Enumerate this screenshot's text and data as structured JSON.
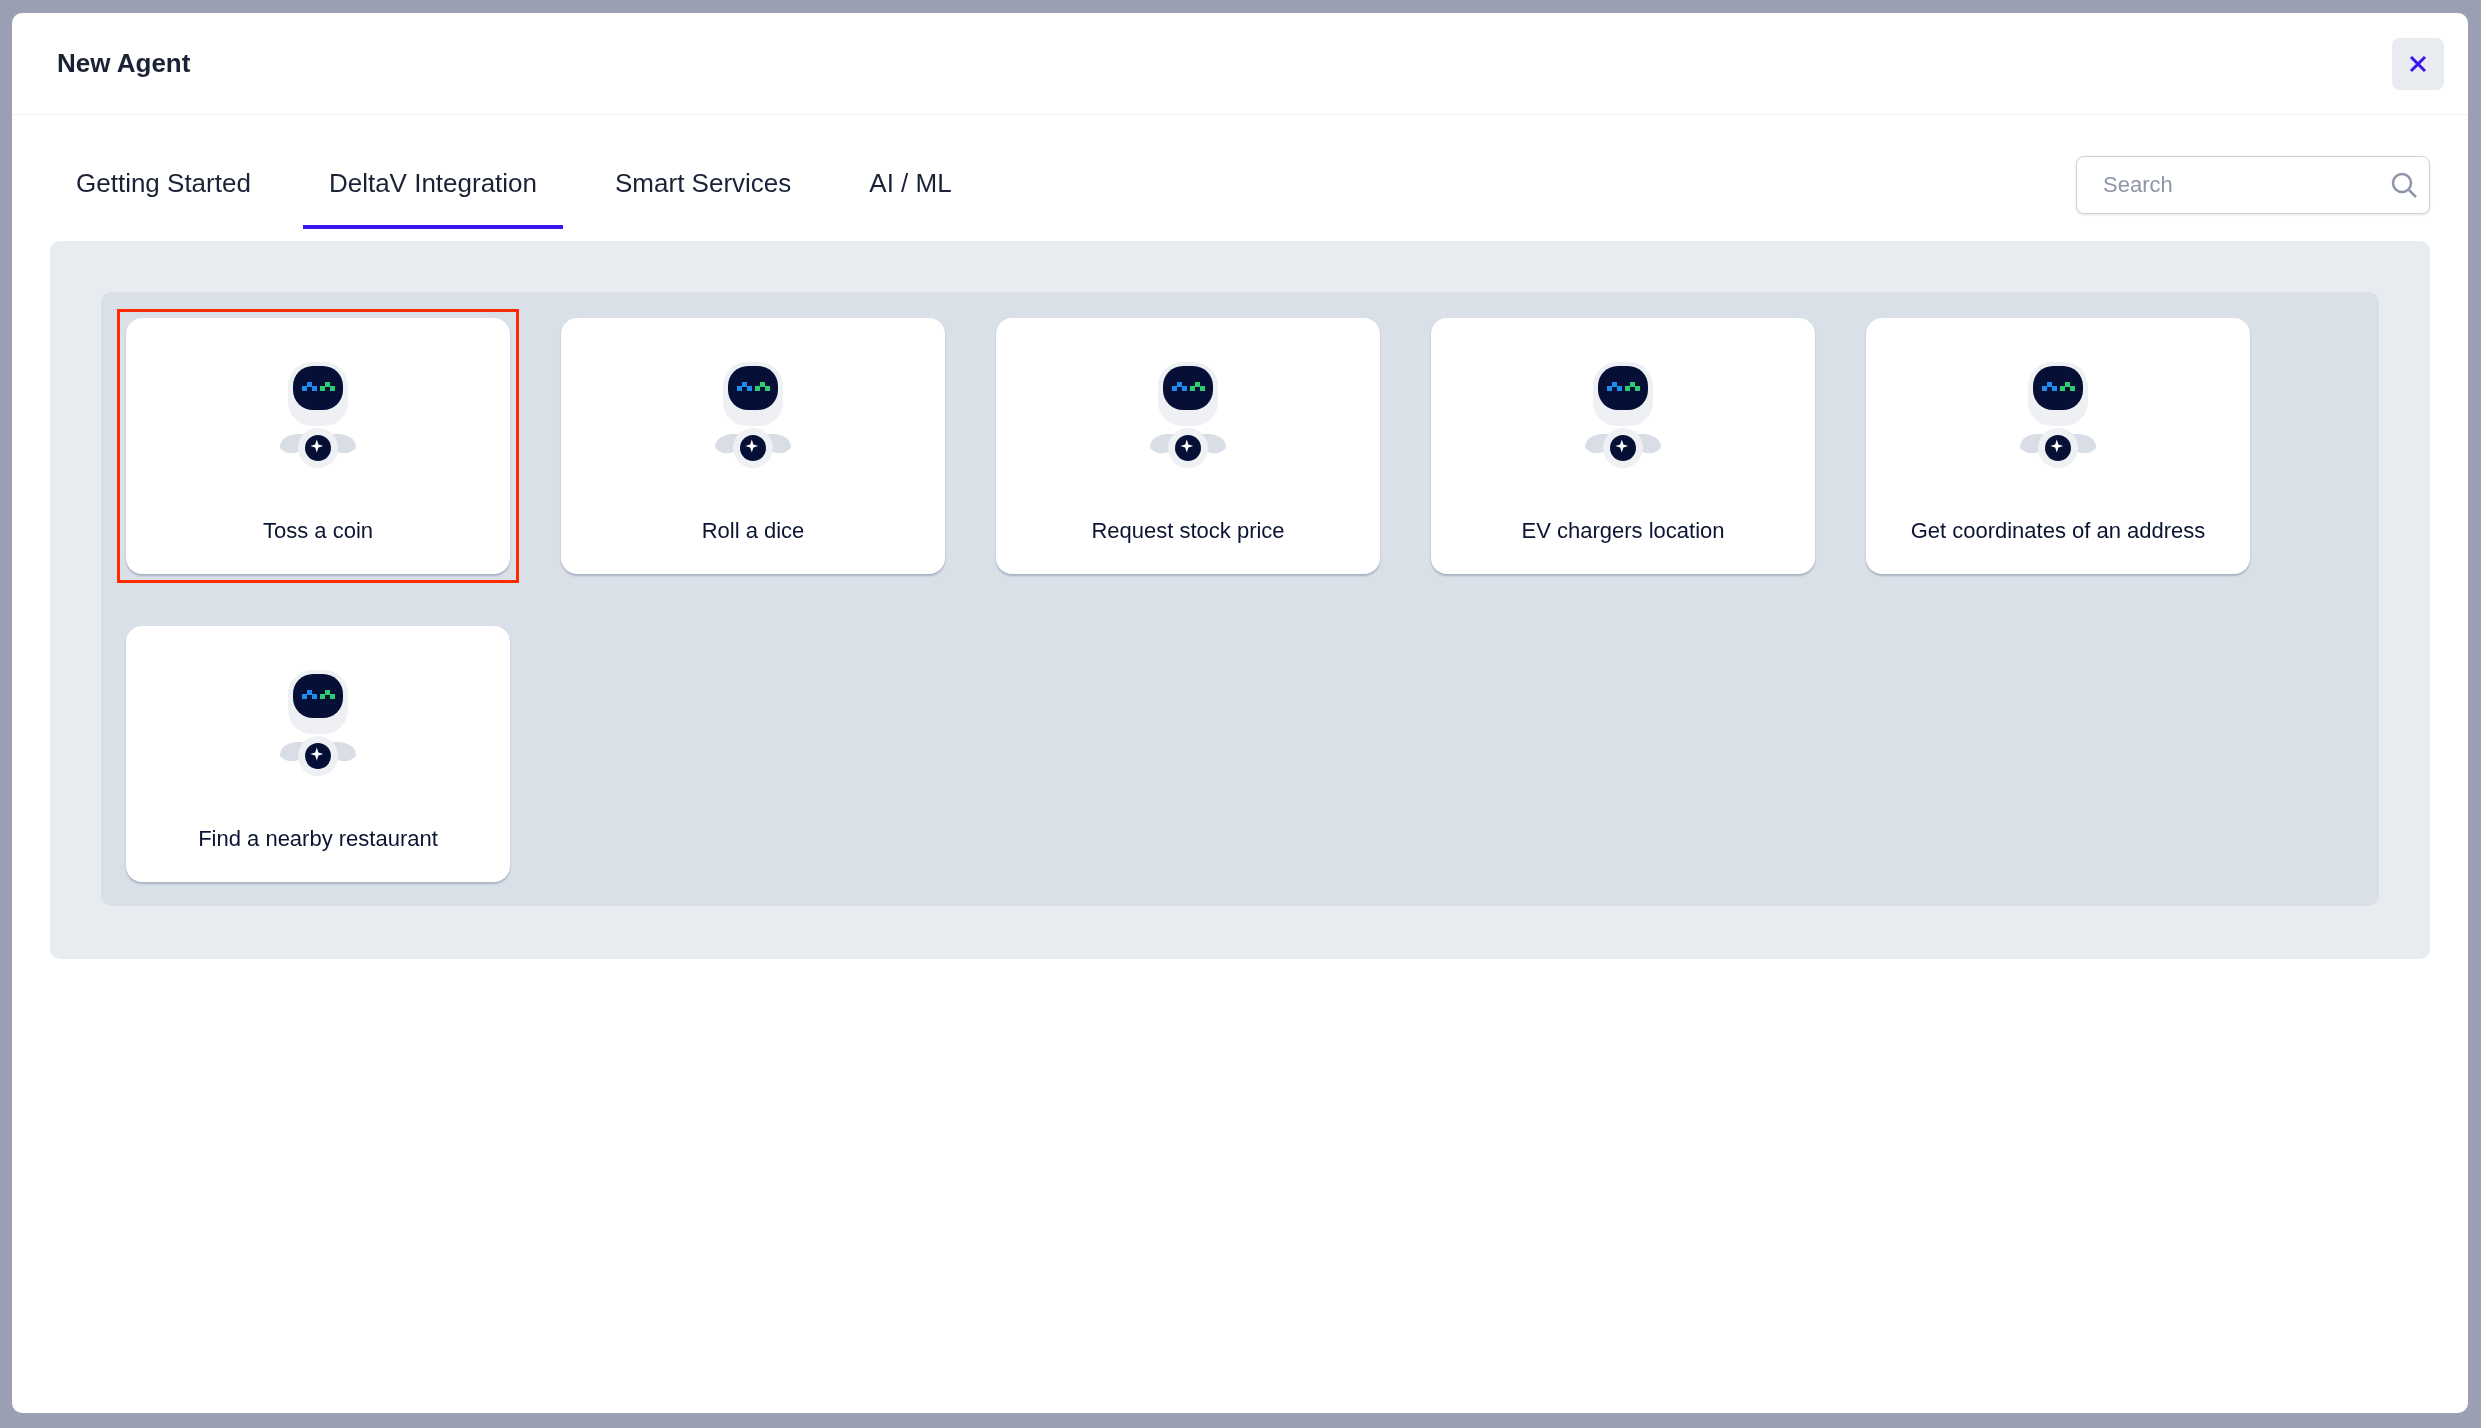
{
  "dialog": {
    "title": "New Agent"
  },
  "tabs": [
    {
      "label": "Getting Started",
      "selected": false
    },
    {
      "label": "DeltaV Integration",
      "selected": true
    },
    {
      "label": "Smart Services",
      "selected": false
    },
    {
      "label": "AI / ML",
      "selected": false
    }
  ],
  "search": {
    "placeholder": "Search"
  },
  "agents": [
    {
      "label": "Toss a coin",
      "selected": true
    },
    {
      "label": "Roll a dice",
      "selected": false
    },
    {
      "label": "Request stock price",
      "selected": false
    },
    {
      "label": "EV chargers location",
      "selected": false
    },
    {
      "label": "Get coordinates of an address",
      "selected": false
    },
    {
      "label": "Find a nearby restaurant",
      "selected": false
    }
  ]
}
